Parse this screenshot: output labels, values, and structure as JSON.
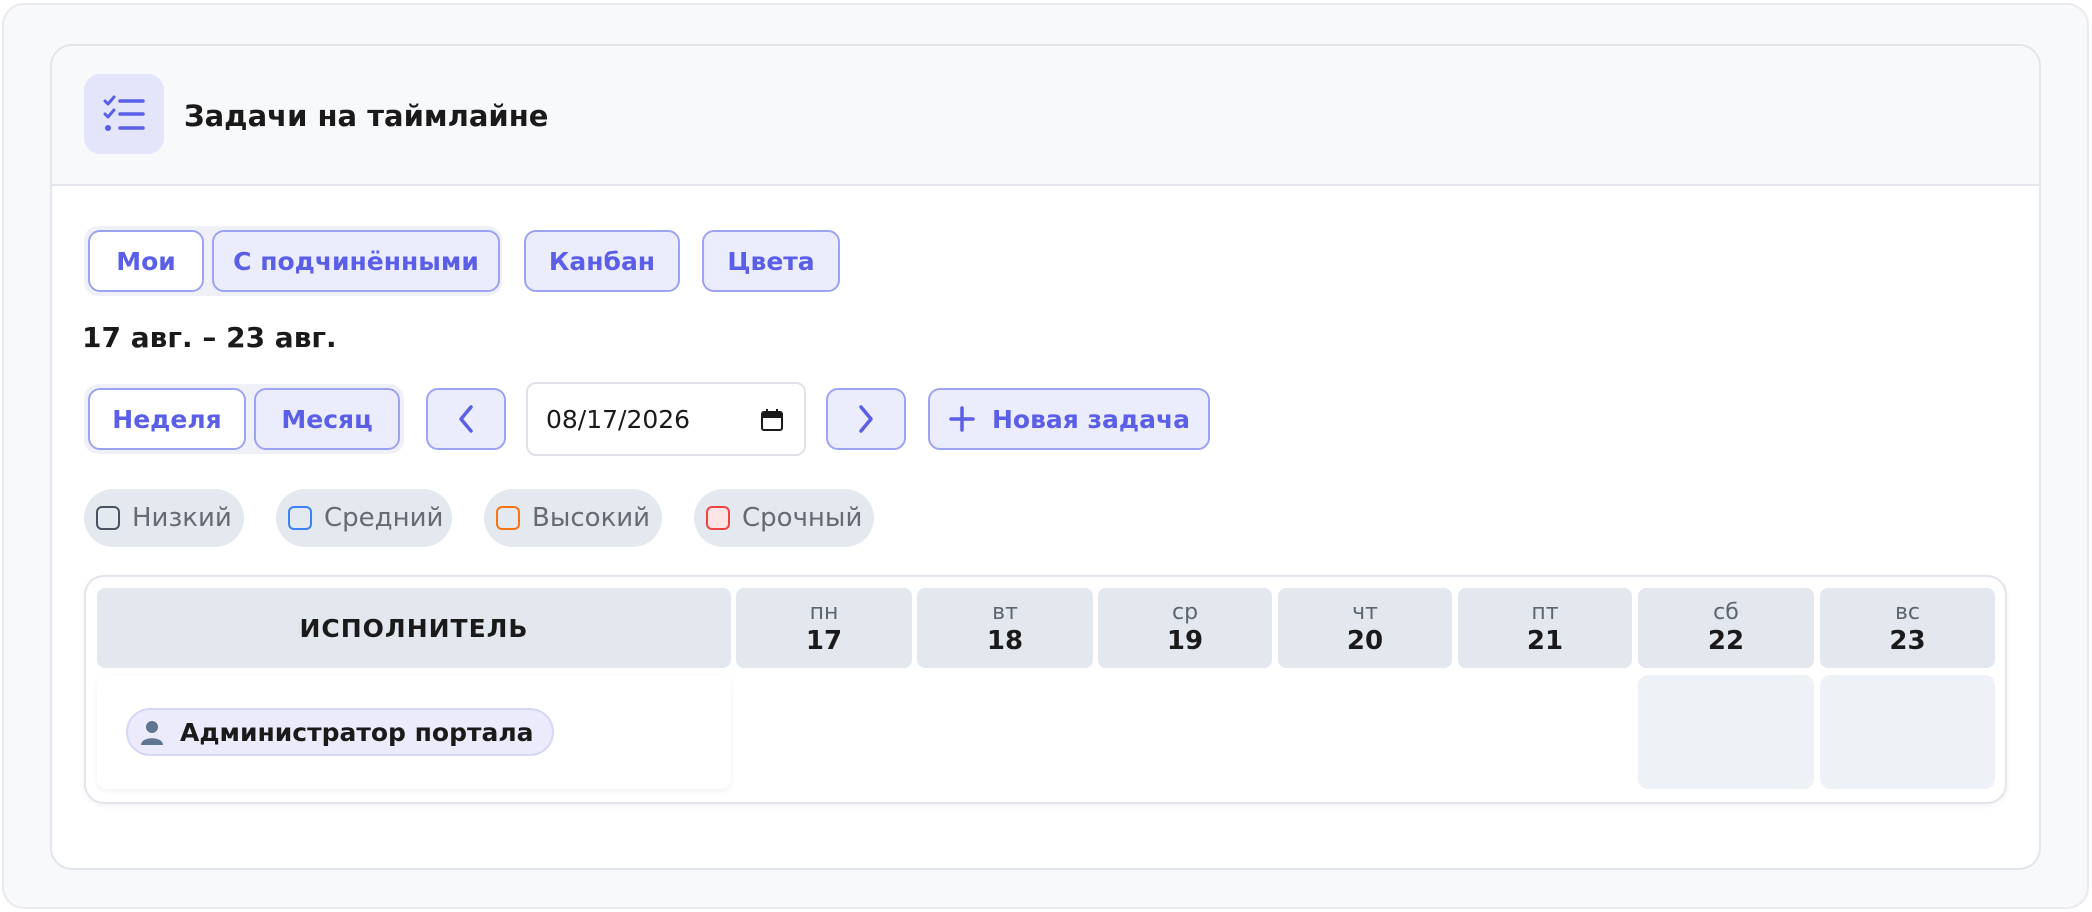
{
  "header": {
    "title": "Задачи на таймлайне",
    "icon": "checklist-icon"
  },
  "view_tabs": [
    {
      "label": "Мои",
      "active": true
    },
    {
      "label": "С подчинёнными",
      "active": false
    }
  ],
  "kanban_label": "Канбан",
  "colors_label": "Цвета",
  "date_range": "17 авг. – 23 авг.",
  "period_tabs": [
    {
      "label": "Неделя",
      "active": true
    },
    {
      "label": "Месяц",
      "active": false
    }
  ],
  "date_input": {
    "value": "08/17/2026"
  },
  "new_task_label": "Новая задача",
  "priorities": [
    {
      "label": "Низкий",
      "color": "#4a5160"
    },
    {
      "label": "Средний",
      "color": "#3b82f6"
    },
    {
      "label": "Высокий",
      "color": "#f97316"
    },
    {
      "label": "Срочный",
      "color": "#ef4444"
    }
  ],
  "table": {
    "assignee_header": "ИСПОЛНИТЕЛЬ",
    "days": [
      {
        "dow": "пн",
        "day": "17"
      },
      {
        "dow": "вт",
        "day": "18"
      },
      {
        "dow": "ср",
        "day": "19"
      },
      {
        "dow": "чт",
        "day": "20"
      },
      {
        "dow": "пт",
        "day": "21"
      },
      {
        "dow": "сб",
        "day": "22"
      },
      {
        "dow": "вс",
        "day": "23"
      }
    ],
    "rows": [
      {
        "assignee": "Администратор портала",
        "icon": "user-icon"
      }
    ]
  },
  "colors": {
    "accent": "#5b5ee6",
    "accent_bg": "#ecedfc",
    "border": "#9da3f2"
  }
}
